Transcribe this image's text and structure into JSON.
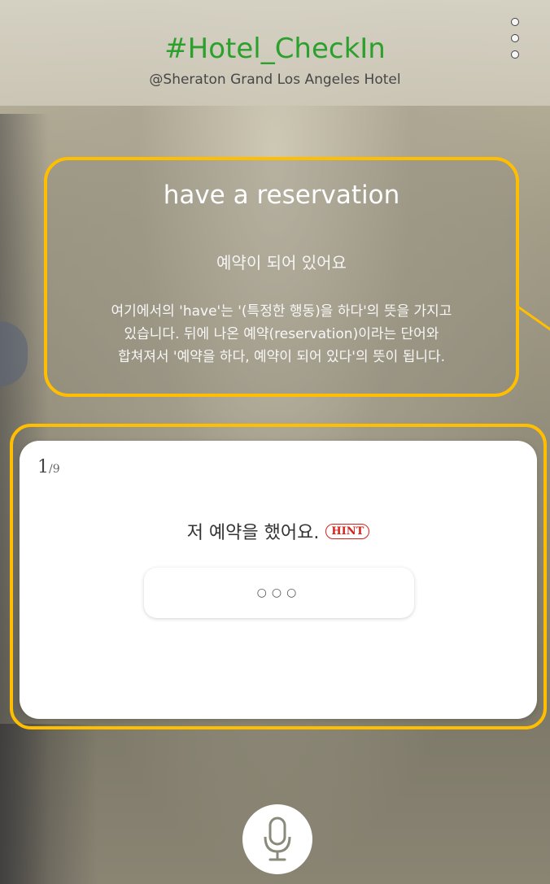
{
  "header": {
    "title": "#Hotel_CheckIn",
    "subtitle": "@Sheraton Grand Los Angeles Hotel",
    "menu_icon": "more-vertical-icon"
  },
  "explanation": {
    "phrase": "have a reservation",
    "meaning": "예약이 되어 있어요",
    "detail": "여기에서의 'have'는 '(특정한 행동)을 하다'의 뜻을 가지고\n있습니다. 뒤에 나온 예약(reservation)이라는 단어와\n합쳐져서 '예약을 하다, 예약이 되어 있다'의 뜻이 됩니다."
  },
  "quiz": {
    "progress_current": "1",
    "progress_total": "/9",
    "prompt": "저 예약을 했어요.",
    "hint_label": "HINT",
    "answer_placeholder": "○○○"
  },
  "mic": {
    "icon": "microphone-icon"
  },
  "colors": {
    "accent_title": "#2ca02c",
    "highlight_border": "#ffbf00",
    "hint_red": "#d8201a"
  }
}
